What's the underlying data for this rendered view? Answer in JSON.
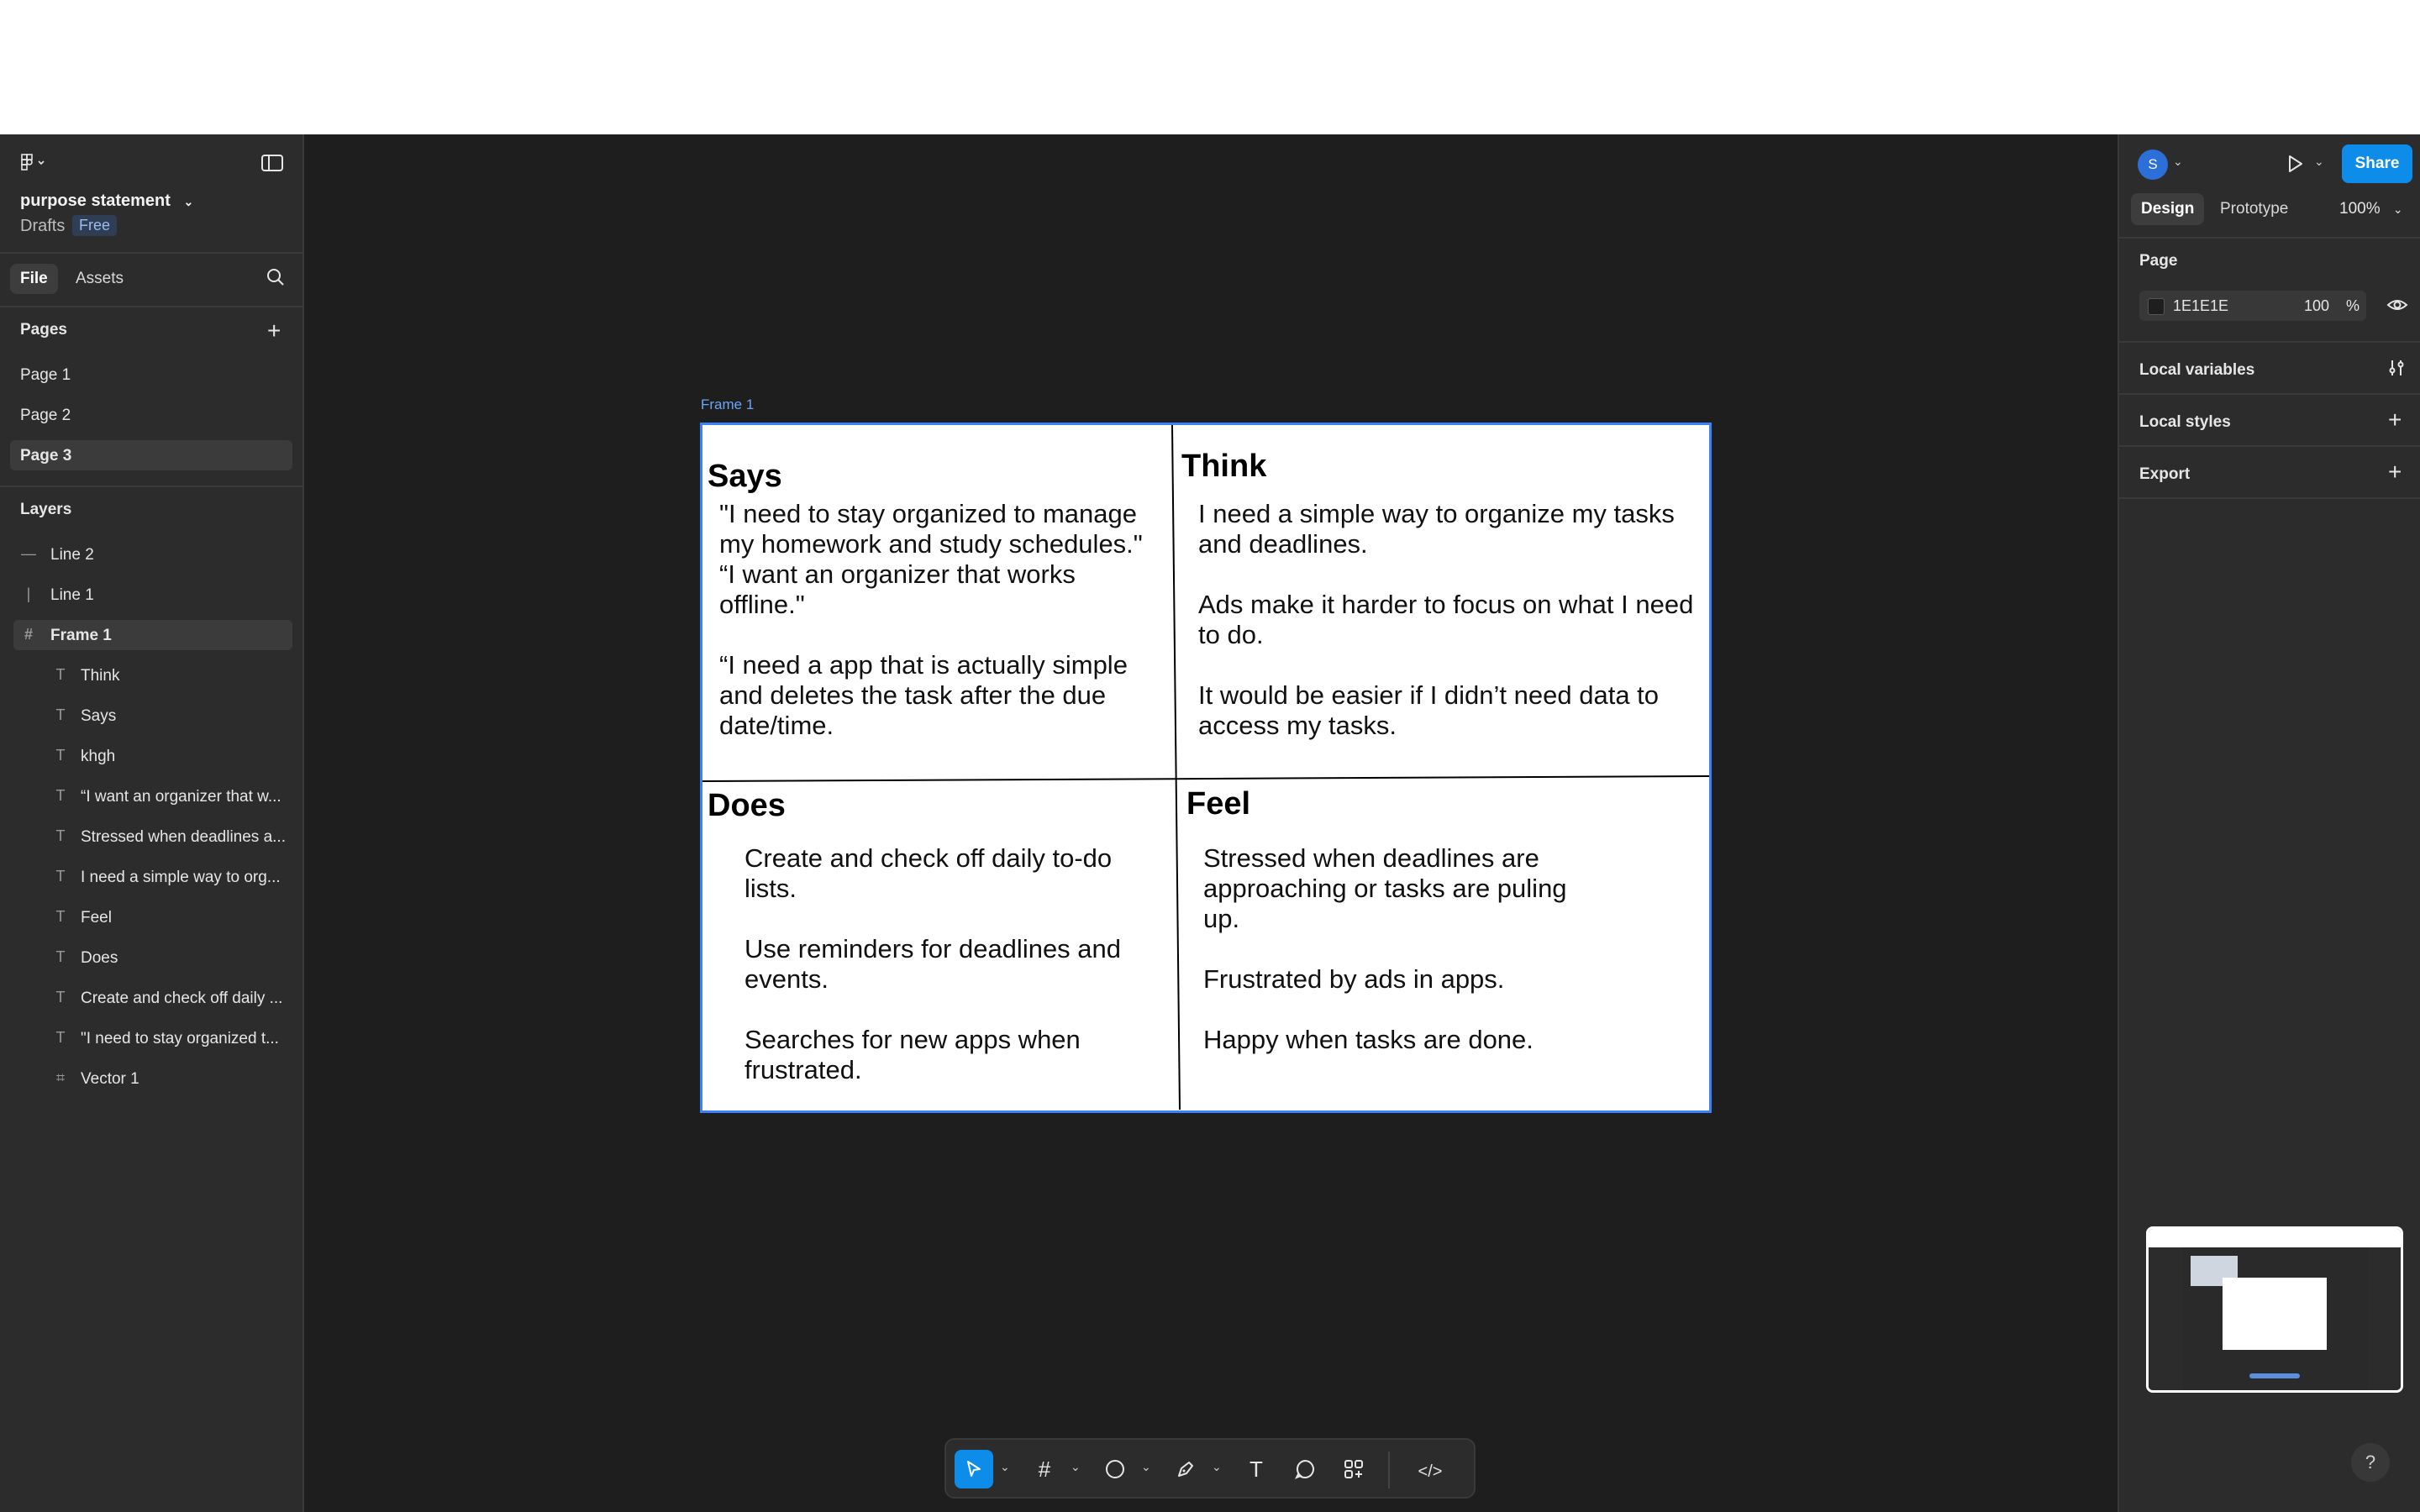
{
  "file": {
    "name": "purpose statement",
    "location": "Drafts",
    "plan_badge": "Free"
  },
  "left_tabs": {
    "file": "File",
    "assets": "Assets"
  },
  "pages": {
    "title": "Pages",
    "items": [
      "Page 1",
      "Page 2",
      "Page 3"
    ],
    "active": "Page 3"
  },
  "layers": {
    "title": "Layers",
    "items": [
      {
        "label": "Line 2",
        "icon": "line-icon"
      },
      {
        "label": "Line 1",
        "icon": "line-icon"
      },
      {
        "label": "Frame 1",
        "icon": "frame-icon"
      },
      {
        "label": "Think",
        "icon": "text-icon"
      },
      {
        "label": "Says",
        "icon": "text-icon"
      },
      {
        "label": "khgh",
        "icon": "text-icon"
      },
      {
        "label": "“I want an organizer that w...",
        "icon": "text-icon"
      },
      {
        "label": "Stressed when deadlines a...",
        "icon": "text-icon"
      },
      {
        "label": "I need a simple way to org...",
        "icon": "text-icon"
      },
      {
        "label": "Feel",
        "icon": "text-icon"
      },
      {
        "label": "Does",
        "icon": "text-icon"
      },
      {
        "label": "Create and check off daily ...",
        "icon": "text-icon"
      },
      {
        "label": "\"I need to stay organized t...",
        "icon": "text-icon"
      },
      {
        "label": "Vector 1",
        "icon": "vector-icon"
      }
    ]
  },
  "right_panel": {
    "avatar_initial": "S",
    "share_label": "Share",
    "tabs": {
      "design": "Design",
      "prototype": "Prototype"
    },
    "zoom": "100%",
    "page_section": "Page",
    "background_hex": "1E1E1E",
    "background_opacity": "100",
    "opacity_unit": "%",
    "local_variables": "Local variables",
    "local_styles": "Local styles",
    "export": "Export"
  },
  "canvas": {
    "frame_label": "Frame 1",
    "says": {
      "title": "Says",
      "lines": [
        "\"I need to stay organized to manage my homework and study schedules.\"",
        "“I want an organizer that works offline.\"",
        "“I need a app that is actually simple and deletes the task after the due date/time."
      ]
    },
    "think": {
      "title": "Think",
      "lines": [
        "I need a simple way to organize my tasks and deadlines.",
        "Ads make it harder to focus on what I need to do.",
        "It would be easier if I didn’t need data to access my tasks."
      ]
    },
    "does": {
      "title": "Does",
      "lines": [
        "Create and check off daily to-do lists.",
        "Use reminders for deadlines and events.",
        "Searches for new apps when frustrated."
      ]
    },
    "feel": {
      "title": "Feel",
      "lines": [
        "Stressed when deadlines are approaching or tasks are puling up.",
        "Frustrated by ads in apps.",
        "Happy when tasks are done."
      ]
    }
  },
  "colors": {
    "accent": "#0d8ce9",
    "selection": "#3b82f6",
    "canvas": "#1e1e1e",
    "panel": "#2c2c2c"
  }
}
